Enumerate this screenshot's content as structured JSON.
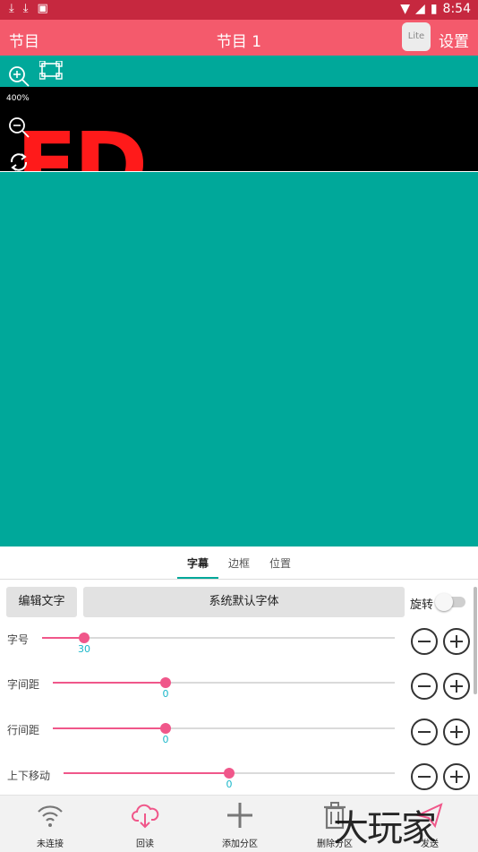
{
  "status_bar": {
    "time": "8:54"
  },
  "app_bar": {
    "left_label": "节目",
    "title": "节目 1",
    "lite_label": "Lite",
    "right_label": "设置"
  },
  "preview": {
    "zoom": "400%",
    "led_text": "ED"
  },
  "tabs": [
    {
      "label": "字幕"
    },
    {
      "label": "边框"
    },
    {
      "label": "位置"
    }
  ],
  "controls": {
    "edit_text": "编辑文字",
    "font": "系统默认字体",
    "rotate": "旋转",
    "sliders": [
      {
        "label": "字号",
        "value": "30",
        "fraction": 0.12
      },
      {
        "label": "字间距",
        "value": "0",
        "fraction": 0.33
      },
      {
        "label": "行间距",
        "value": "0",
        "fraction": 0.33
      },
      {
        "label": "上下移动",
        "value": "0",
        "fraction": 0.5
      }
    ]
  },
  "nav": [
    {
      "label": "未连接",
      "icon": "wifi-icon"
    },
    {
      "label": "回读",
      "icon": "cloud-download-icon"
    },
    {
      "label": "添加分区",
      "icon": "plus-icon"
    },
    {
      "label": "删除分区",
      "icon": "trash-icon"
    },
    {
      "label": "发送",
      "icon": "send-icon"
    }
  ],
  "watermark": "大玩家",
  "colors": {
    "status_bar": "#c6283f",
    "app_bar": "#f45a6c",
    "teal": "#00a89a",
    "accent": "#f0578a",
    "value_text": "#19b7c9",
    "led_red": "#ff1a1a"
  }
}
